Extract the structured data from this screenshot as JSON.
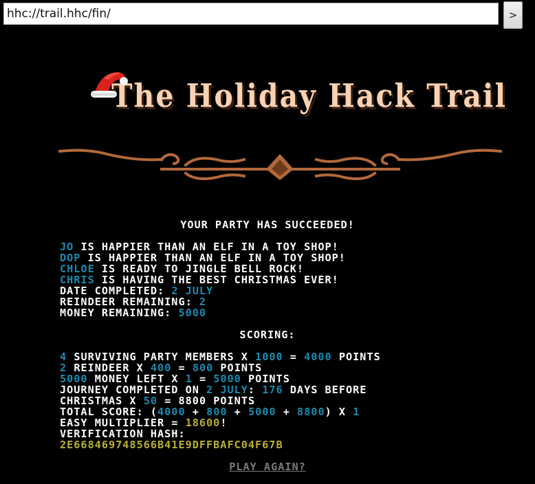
{
  "browser": {
    "url": "hhc://trail.hhc/fin/",
    "go_label": ">"
  },
  "title": "The Holiday Hack Trail",
  "results": {
    "heading": "YOUR PARTY HAS SUCCEEDED!",
    "party": [
      {
        "name": "JO",
        "status": "IS HAPPIER THAN AN ELF IN A TOY SHOP!"
      },
      {
        "name": "DOP",
        "status": "IS HAPPIER THAN AN ELF IN A TOY SHOP!"
      },
      {
        "name": "CHLOE",
        "status": "IS READY TO JINGLE BELL ROCK!"
      },
      {
        "name": "CHRIS",
        "status": "IS HAVING THE BEST CHRISTMAS EVER!"
      }
    ],
    "date_label": "DATE COMPLETED:",
    "date_value": "2 JULY",
    "reindeer_label": "REINDEER REMAINING:",
    "reindeer_value": "2",
    "money_label": "MONEY REMAINING:",
    "money_value": "5000"
  },
  "scoring": {
    "heading": "SCORING:",
    "members": {
      "count": "4",
      "label": "SURVIVING PARTY MEMBERS X",
      "mult": "1000",
      "eq": "=",
      "total": "4000",
      "unit": "POINTS"
    },
    "reindeer": {
      "count": "2",
      "label": "REINDEER X",
      "mult": "400",
      "eq": "=",
      "total": "800",
      "unit": "POINTS"
    },
    "money": {
      "count": "5000",
      "label": "MONEY LEFT X",
      "mult": "1",
      "eq": "=",
      "total": "5000",
      "unit": "POINTS"
    },
    "journey": {
      "label": "JOURNEY COMPLETED ON",
      "date": "2 JULY",
      "colon": ":",
      "days": "176",
      "days_label": "DAYS BEFORE",
      "line2_label": "CHRISTMAS X",
      "mult": "50",
      "eq": "=",
      "total": "8800",
      "unit": "POINTS"
    },
    "total": {
      "label": "TOTAL SCORE: (",
      "v1": "4000",
      "plus1": "+",
      "v2": "800",
      "plus2": "+",
      "v3": "5000",
      "plus3": "+",
      "v4": "8800",
      "close": ") X",
      "mult": "1"
    },
    "multiplier": {
      "label": "EASY MULTIPLIER =",
      "value": "18600",
      "end": "!"
    },
    "hash": {
      "label": "VERIFICATION HASH:",
      "value": "2E668469748566B41E9DFFBAFC04F67B"
    }
  },
  "play_again": "PLAY AGAIN?",
  "colors": {
    "background": "#000000",
    "title": "#f8d2b2",
    "highlight_cyan": "#1c8ab0",
    "highlight_yellow": "#b9b034",
    "divider": "#b2693c"
  }
}
